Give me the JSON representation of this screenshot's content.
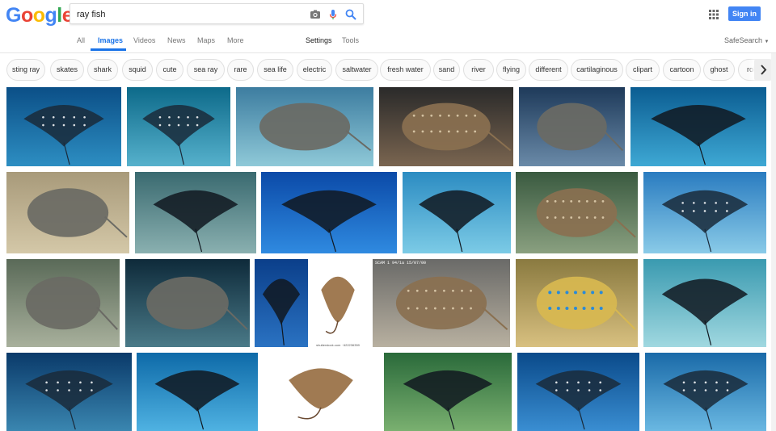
{
  "header": {
    "logo_letters": [
      {
        "ch": "G",
        "color": "#4285F4"
      },
      {
        "ch": "o",
        "color": "#EA4335"
      },
      {
        "ch": "o",
        "color": "#FBBC05"
      },
      {
        "ch": "g",
        "color": "#4285F4"
      },
      {
        "ch": "l",
        "color": "#34A853"
      },
      {
        "ch": "e",
        "color": "#EA4335"
      }
    ],
    "search_value": "ray fish",
    "signin_label": "Sign in",
    "icons": [
      "camera-icon",
      "microphone-icon",
      "search-icon",
      "apps-grid-icon"
    ]
  },
  "nav": {
    "tabs": [
      "All",
      "Images",
      "Videos",
      "News",
      "Maps",
      "More"
    ],
    "active": "Images",
    "settings": "Settings",
    "tools": "Tools",
    "safesearch": "SafeSearch"
  },
  "chips": [
    "sting ray",
    "skates",
    "shark",
    "squid",
    "cute",
    "sea ray",
    "rare",
    "sea life",
    "electric",
    "saltwater",
    "fresh water",
    "sand",
    "river",
    "flying",
    "different",
    "cartilaginous",
    "clipart",
    "cartoon",
    "ghost",
    "robo"
  ],
  "images": {
    "watermark": "shutterstock.com · 622236359",
    "timestamp": "SCAM 1 94/1a  15/07/00"
  },
  "colors": {
    "accent": "#1a73e8",
    "signin": "#4285f4"
  }
}
